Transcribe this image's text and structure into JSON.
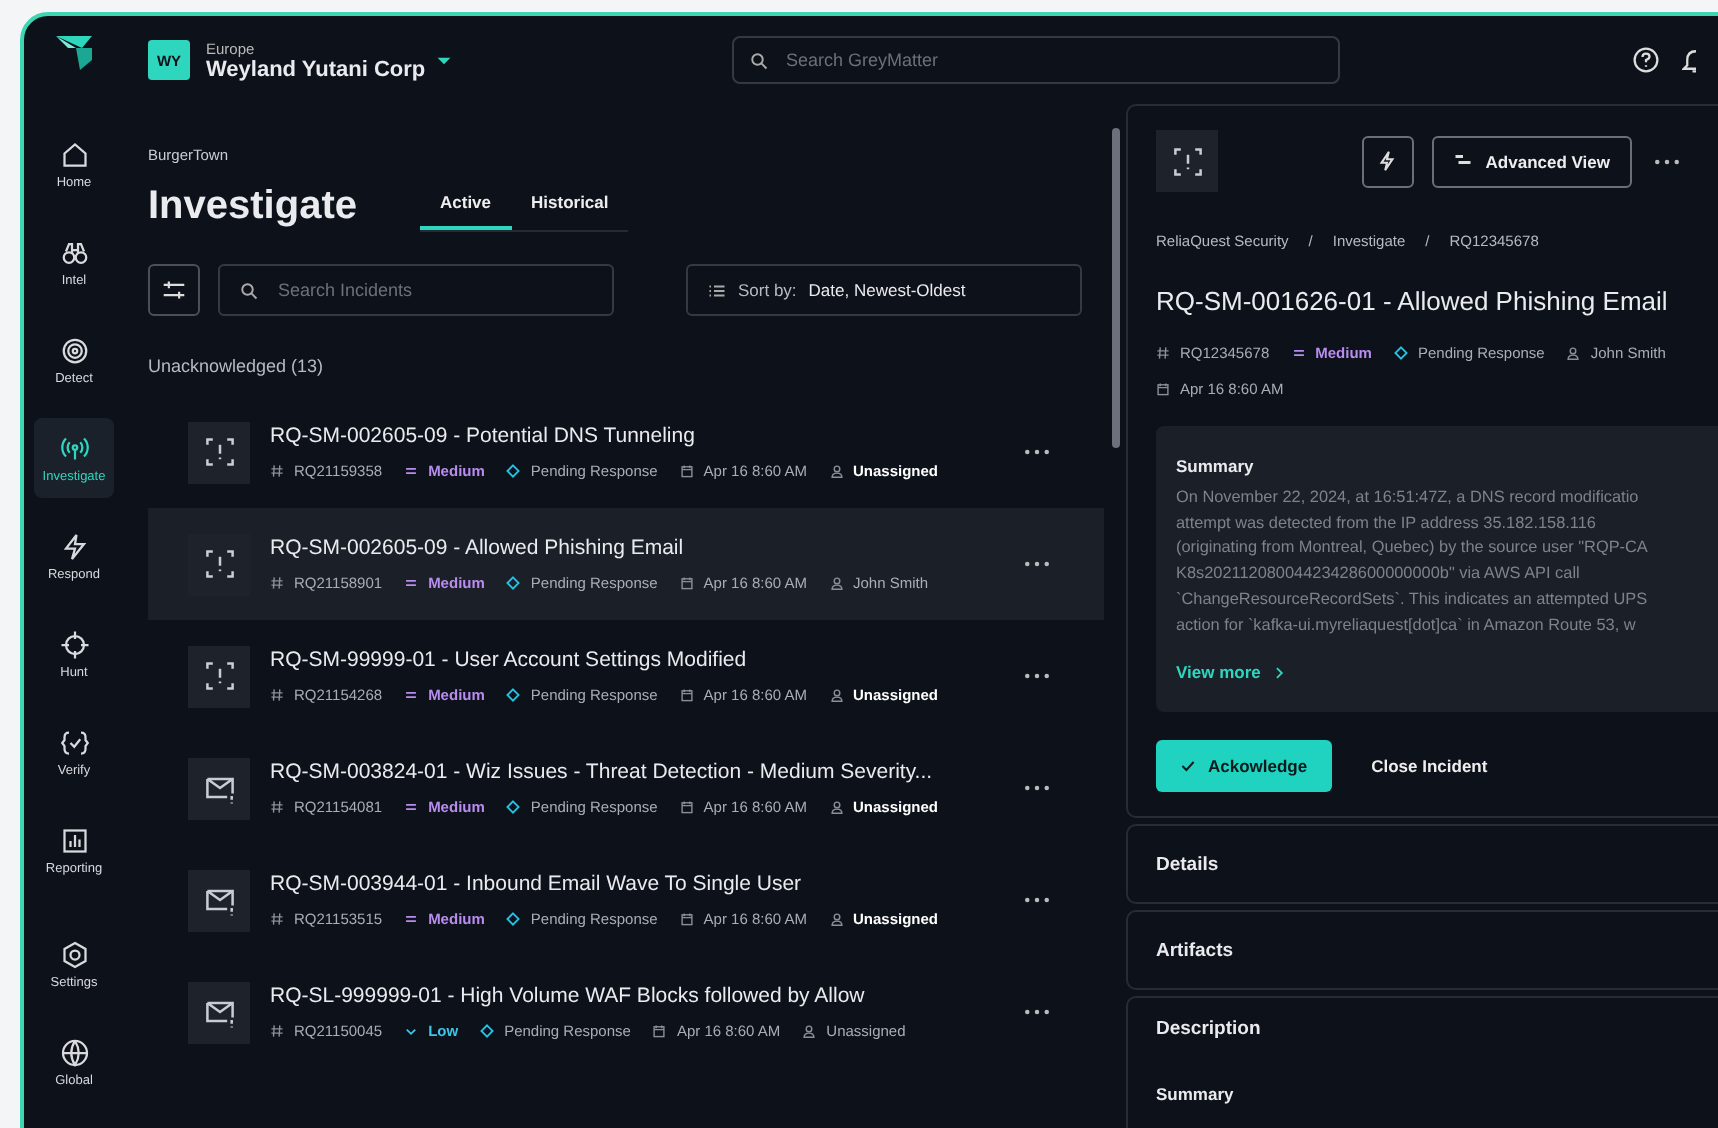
{
  "org": {
    "badge": "WY",
    "region": "Europe",
    "name": "Weyland Yutani Corp"
  },
  "search": {
    "placeholder": "Search GreyMatter"
  },
  "nav": [
    {
      "label": "Home",
      "selected": false
    },
    {
      "label": "Intel",
      "selected": false
    },
    {
      "label": "Detect",
      "selected": false
    },
    {
      "label": "Investigate",
      "selected": true
    },
    {
      "label": "Respond",
      "selected": false
    },
    {
      "label": "Hunt",
      "selected": false
    },
    {
      "label": "Verify",
      "selected": false
    },
    {
      "label": "Reporting",
      "selected": false
    },
    {
      "label": "Settings",
      "selected": false
    },
    {
      "label": "Global",
      "selected": false
    }
  ],
  "breadcrumb": "BurgerTown",
  "title": "Investigate",
  "tabs": [
    {
      "label": "Active",
      "selected": true
    },
    {
      "label": "Historical",
      "selected": false
    }
  ],
  "incident_search": {
    "placeholder": "Search Incidents"
  },
  "sort": {
    "label": "Sort by:",
    "value": "Date, Newest-Oldest"
  },
  "group_heading": "Unacknowledged (13)",
  "incidents": [
    {
      "kind": "alert",
      "title": "RQ-SM-002605-09 - Potential DNS Tunneling",
      "id": "RQ21159358",
      "priority": {
        "label": "Medium",
        "kind": "medium"
      },
      "status": "Pending Response",
      "date": "Apr 16 8:60 AM",
      "assignee": "Unassigned",
      "assignee_emphasis": true,
      "selected": false
    },
    {
      "kind": "alert",
      "title": "RQ-SM-002605-09 - Allowed Phishing Email",
      "id": "RQ21158901",
      "priority": {
        "label": "Medium",
        "kind": "medium"
      },
      "status": "Pending Response",
      "date": "Apr 16 8:60 AM",
      "assignee": "John Smith",
      "assignee_emphasis": false,
      "selected": true
    },
    {
      "kind": "alert",
      "title": "RQ-SM-99999-01 - User Account Settings Modified",
      "id": "RQ21154268",
      "priority": {
        "label": "Medium",
        "kind": "medium"
      },
      "status": "Pending Response",
      "date": "Apr 16 8:60 AM",
      "assignee": "Unassigned",
      "assignee_emphasis": true,
      "selected": false
    },
    {
      "kind": "email",
      "title": "RQ-SM-003824-01 - Wiz Issues - Threat Detection - Medium Severity...",
      "id": "RQ21154081",
      "priority": {
        "label": "Medium",
        "kind": "medium"
      },
      "status": "Pending Response",
      "date": "Apr 16 8:60 AM",
      "assignee": "Unassigned",
      "assignee_emphasis": true,
      "selected": false
    },
    {
      "kind": "email",
      "title": "RQ-SM-003944-01 - Inbound Email Wave To Single User",
      "id": "RQ21153515",
      "priority": {
        "label": "Medium",
        "kind": "medium"
      },
      "status": "Pending Response",
      "date": "Apr 16 8:60 AM",
      "assignee": "Unassigned",
      "assignee_emphasis": true,
      "selected": false
    },
    {
      "kind": "email",
      "title": "RQ-SL-999999-01 - High Volume WAF Blocks followed by Allow",
      "id": "RQ21150045",
      "priority": {
        "label": "Low",
        "kind": "low"
      },
      "status": "Pending Response",
      "date": "Apr 16 8:60 AM",
      "assignee": "Unassigned",
      "assignee_emphasis": false,
      "selected": false
    }
  ],
  "detail": {
    "advanced_view": "Advanced View",
    "breadcrumb": [
      "ReliaQuest Security",
      "/",
      "Investigate",
      "/",
      "RQ12345678"
    ],
    "title": "RQ-SM-001626-01 - Allowed Phishing Email",
    "id": "RQ12345678",
    "priority": {
      "label": "Medium",
      "kind": "medium"
    },
    "status": "Pending Response",
    "assignee": "John Smith",
    "date": "Apr 16 8:60 AM",
    "summary_heading": "Summary",
    "summary_lines": [
      "On November 22, 2024, at 16:51:47Z, a DNS record modificatio",
      "attempt was detected from the IP address 35.182.158.116",
      "(originating from Montreal, Quebec) by the source user \"RQP-CA",
      "K8s20211208004423428600000000b\" via AWS API call",
      "`ChangeResourceRecordSets`. This indicates an attempted UPS",
      "action for `kafka-ui.myreliaquest[dot]ca` in Amazon Route 53, w"
    ],
    "view_more": "View more",
    "acknowledge": "Ackowledge",
    "close": "Close Incident",
    "sections": [
      "Details",
      "Artifacts",
      "Description"
    ],
    "description_subheading": "Summary"
  }
}
